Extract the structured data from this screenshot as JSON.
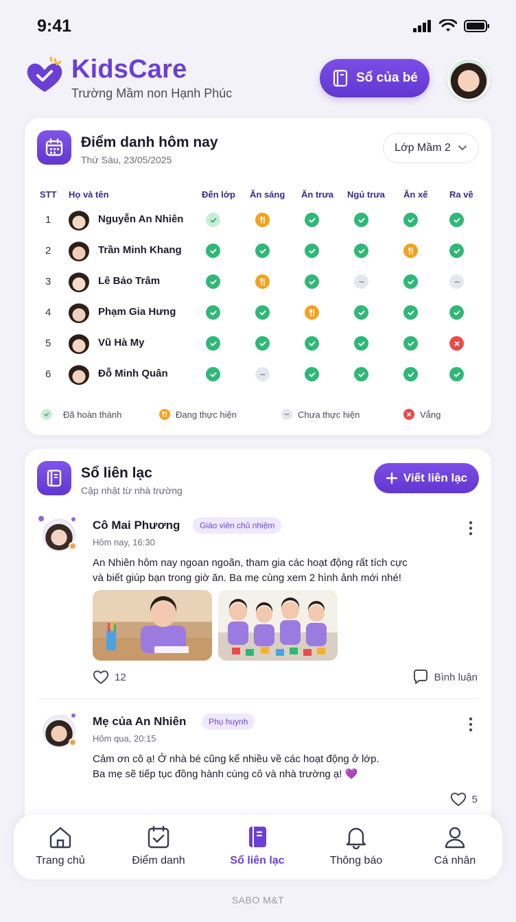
{
  "status_bar": {
    "time": "9:41"
  },
  "header": {
    "brand": "KidsCare",
    "school": "Trường Mầm non Hạnh Phúc",
    "book_button": "Sổ của bé"
  },
  "attendance": {
    "title": "Điểm danh hôm nay",
    "date": "Thứ Sáu, 23/05/2025",
    "class_select": "Lớp Mầm 2",
    "columns": [
      "STT",
      "Họ và tên",
      "Đến lớp",
      "Ăn sáng",
      "Ăn trưa",
      "Ngủ trưa",
      "Ăn xế",
      "Ra về"
    ],
    "rows": [
      {
        "stt": "1",
        "name": "Nguyễn An Nhiên",
        "status": [
          "done-light",
          "progress",
          "done",
          "done",
          "done",
          "done"
        ]
      },
      {
        "stt": "2",
        "name": "Trần Minh Khang",
        "status": [
          "done",
          "done",
          "done",
          "done",
          "progress",
          "done"
        ]
      },
      {
        "stt": "3",
        "name": "Lê Bảo Trâm",
        "status": [
          "done",
          "progress",
          "done",
          "none",
          "done",
          "none"
        ]
      },
      {
        "stt": "4",
        "name": "Phạm Gia Hưng",
        "status": [
          "done",
          "done",
          "progress",
          "done",
          "done",
          "done"
        ]
      },
      {
        "stt": "5",
        "name": "Vũ Hà My",
        "status": [
          "done",
          "done",
          "done",
          "done",
          "done",
          "absent"
        ]
      },
      {
        "stt": "6",
        "name": "Đỗ Minh Quân",
        "status": [
          "done",
          "none",
          "done",
          "done",
          "done",
          "done"
        ]
      }
    ],
    "legend": {
      "done": "Đã hoàn thành",
      "progress": "Đang thực hiện",
      "none": "Chưa thực hiện",
      "absent": "Vắng"
    }
  },
  "notebook": {
    "title": "Sổ liên lạc",
    "subtitle": "Cập nhật từ nhà trường",
    "write_button": "Viết liên lạc",
    "posts": [
      {
        "author": "Cô Mai Phương",
        "role": "Giáo viên chủ nhiệm",
        "time": "Hôm nay, 16:30",
        "text_line1": "An Nhiên hôm nay ngoan ngoãn, tham gia các hoạt động rất tích cực",
        "text_line2": "và biết giúp bạn trong giờ ăn. Ba mẹ cùng xem 2 hình ảnh mới nhé!",
        "likes": "12",
        "comment_label": "Bình luận"
      },
      {
        "author": "Mẹ của An Nhiên",
        "role": "Phụ huynh",
        "time": "Hôm qua, 20:15",
        "text_line1": "Cảm ơn cô ạ! Ở nhà bé cũng kể nhiều về các hoạt động ở lớp.",
        "text_line2": "Ba mẹ sẽ tiếp tục đồng hành cùng cô và nhà trường ạ! 💜",
        "likes": "5"
      }
    ]
  },
  "nav": {
    "items": [
      {
        "label": "Trang chủ"
      },
      {
        "label": "Điểm danh"
      },
      {
        "label": "Sổ liên lạc"
      },
      {
        "label": "Thông báo"
      },
      {
        "label": "Cá nhân"
      }
    ],
    "active_index": 2
  },
  "footer": "SABO M&T",
  "colors": {
    "accent": "#6b3fd6",
    "done": "#2fb877",
    "progress": "#f6a11c",
    "absent": "#ea4a4a"
  }
}
